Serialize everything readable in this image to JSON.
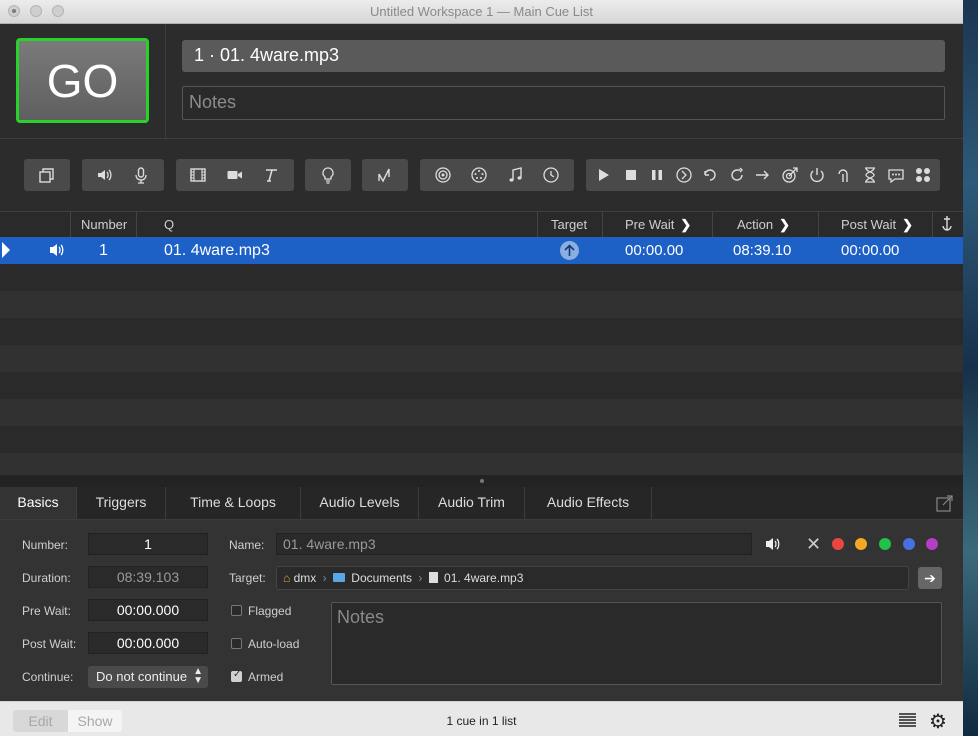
{
  "window": {
    "title": "Untitled Workspace 1 — Main Cue List"
  },
  "header": {
    "go_label": "GO",
    "cue_title": "1 · 01. 4ware.mp3",
    "notes_placeholder": "Notes"
  },
  "toolbar": {
    "icons": [
      "group-icon",
      "audio-icon",
      "mic-icon",
      "video-icon",
      "camera-icon",
      "text-icon",
      "light-icon",
      "fade-icon",
      "network-icon",
      "midi-icon",
      "music-icon",
      "timecode-icon",
      "start-icon",
      "stop-icon",
      "pause-icon",
      "load-icon",
      "reset-icon",
      "devamp-icon",
      "goto-icon",
      "target-icon",
      "arm-icon",
      "disarm-icon",
      "wait-icon",
      "memo-icon",
      "script-icon"
    ]
  },
  "columns": {
    "number": "Number",
    "q": "Q",
    "target": "Target",
    "pre_wait": "Pre Wait",
    "action": "Action",
    "post_wait": "Post Wait"
  },
  "cue_rows": [
    {
      "number": "1",
      "name": "01. 4ware.mp3",
      "pre_wait": "00:00.00",
      "action": "08:39.10",
      "post_wait": "00:00.00",
      "type_icon": "speaker-icon",
      "target_icon": "up-arrow-circle-icon"
    }
  ],
  "tabs": [
    "Basics",
    "Triggers",
    "Time & Loops",
    "Audio Levels",
    "Audio Trim",
    "Audio Effects"
  ],
  "inspector": {
    "number_label": "Number:",
    "number_value": "1",
    "duration_label": "Duration:",
    "duration_value": "08:39.103",
    "prewait_label": "Pre Wait:",
    "prewait_value": "00:00.000",
    "postwait_label": "Post Wait:",
    "postwait_value": "00:00.000",
    "continue_label": "Continue:",
    "continue_value": "Do not continue",
    "name_label": "Name:",
    "name_placeholder": "01. 4ware.mp3",
    "target_label": "Target:",
    "target_path": [
      "dmx",
      "Documents",
      "01. 4ware.mp3"
    ],
    "flagged_label": "Flagged",
    "flagged": false,
    "autoload_label": "Auto-load",
    "autoload": false,
    "armed_label": "Armed",
    "armed": true,
    "notes_placeholder": "Notes",
    "color_dots": [
      "#e8463f",
      "#f5a623",
      "#22c24a",
      "#4a6fe0",
      "#b23fc4"
    ]
  },
  "statusbar": {
    "edit_label": "Edit",
    "show_label": "Show",
    "cue_count": "1 cue in 1 list"
  }
}
